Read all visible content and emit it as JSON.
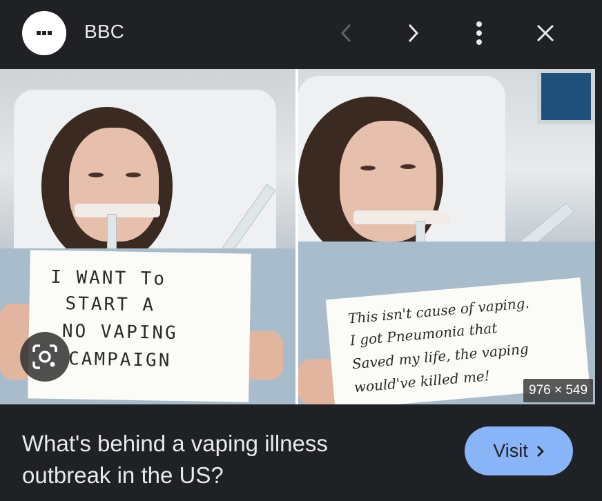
{
  "header": {
    "site_icon": "more-dots-icon",
    "site_name": "BBC",
    "prev_icon": "chevron-left-icon",
    "next_icon": "chevron-right-icon",
    "menu_icon": "more-vertical-icon",
    "close_icon": "close-icon"
  },
  "image": {
    "left_sign_lines": [
      "I WANT To",
      "START  A",
      "NO VAPING",
      "CAMPAIGN"
    ],
    "right_sign_lines": [
      "This isn't cause of vaping.",
      "I got Pneumonia that",
      "Saved my life, the vaping",
      "would've killed me!"
    ],
    "dimensions": "976 × 549",
    "lens_icon": "visual-search-icon",
    "carousel": {
      "count": 3,
      "active_index": 1
    }
  },
  "footer": {
    "caption": "What's behind a vaping illness outbreak in the US?",
    "visit_label": "Visit",
    "visit_icon": "chevron-right-icon"
  },
  "colors": {
    "background": "#202124",
    "text": "#e8eaed",
    "visit_button": "#8ab4f8",
    "disabled_icon": "#5f6368"
  }
}
